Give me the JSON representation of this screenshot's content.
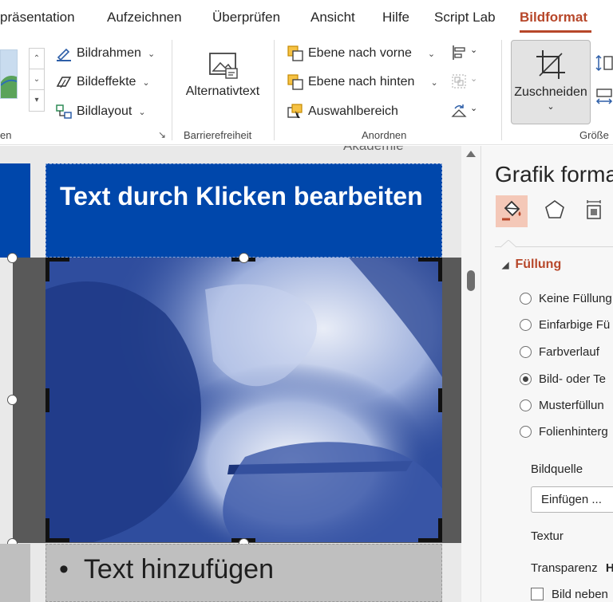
{
  "tabs": [
    {
      "label": "präsentation",
      "active": false
    },
    {
      "label": "Aufzeichnen",
      "active": false
    },
    {
      "label": "Überprüfen",
      "active": false
    },
    {
      "label": "Ansicht",
      "active": false
    },
    {
      "label": "Hilfe",
      "active": false
    },
    {
      "label": "Script Lab",
      "active": false
    },
    {
      "label": "Bildformat",
      "active": true
    }
  ],
  "ribbon": {
    "picture_styles": {
      "bildrahmen": "Bildrahmen",
      "bildeffekte": "Bildeffekte",
      "bildlayout": "Bildlayout",
      "group_label": "en"
    },
    "accessibility": {
      "alt_text": "Alternativtext",
      "group_label": "Barrierefreiheit"
    },
    "arrange": {
      "bring_forward": "Ebene nach vorne",
      "send_backward": "Ebene nach hinten",
      "selection_pane": "Auswahlbereich",
      "group_label": "Anordnen"
    },
    "size": {
      "crop": "Zuschneiden",
      "group_label": "Größe"
    }
  },
  "slide": {
    "title": "Text durch Klicken bearbeiten",
    "content_bullet": "•",
    "content_text": "Text hinzufügen",
    "behind_text": "Akademie"
  },
  "format_pane": {
    "title": "Grafik forma",
    "section_title": "Füllung",
    "fill_options": [
      {
        "label": "Keine Füllung",
        "selected": false
      },
      {
        "label": "Einfarbige Fü",
        "selected": false
      },
      {
        "label": "Farbverlauf",
        "selected": false
      },
      {
        "label": "Bild- oder Te",
        "selected": true
      },
      {
        "label": "Musterfüllun",
        "selected": false
      },
      {
        "label": "Folienhinterg",
        "selected": false
      }
    ],
    "image_source_label": "Bildquelle",
    "insert_button": "Einfügen ...",
    "texture_label": "Textur",
    "transparency_label": "Transparenz",
    "transparency_value_hint": "H",
    "tile_checkbox_label": "Bild neben"
  },
  "colors": {
    "accent": "#b7472a",
    "slide_blue": "#0047ab",
    "fill_tab_highlight": "#f4c8b8"
  }
}
